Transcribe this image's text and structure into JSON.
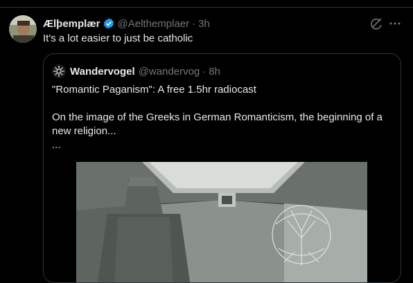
{
  "tweet": {
    "author_name": "Ælþemplær",
    "handle": "@Aelthemplaer",
    "separator": "·",
    "time": "3h",
    "text": "It's a lot easier to just be catholic",
    "icons": [
      "verified-badge-icon",
      "grok-icon",
      "more-icon"
    ]
  },
  "quoted": {
    "author_name": "Wandervogel",
    "handle": "@wandervog",
    "separator": "·",
    "time": "8h",
    "lines": [
      "\"Romantic Paganism\": A free 1.5hr radiocast",
      "",
      "On the image of the Greeks in German Romanticism, the beginning of a",
      "new religion...",
      "..."
    ]
  },
  "colors": {
    "background": "#000000",
    "text": "#e7e9ea",
    "secondary": "#71767b",
    "border": "#2f3336",
    "verified": "#1d9bf0"
  }
}
